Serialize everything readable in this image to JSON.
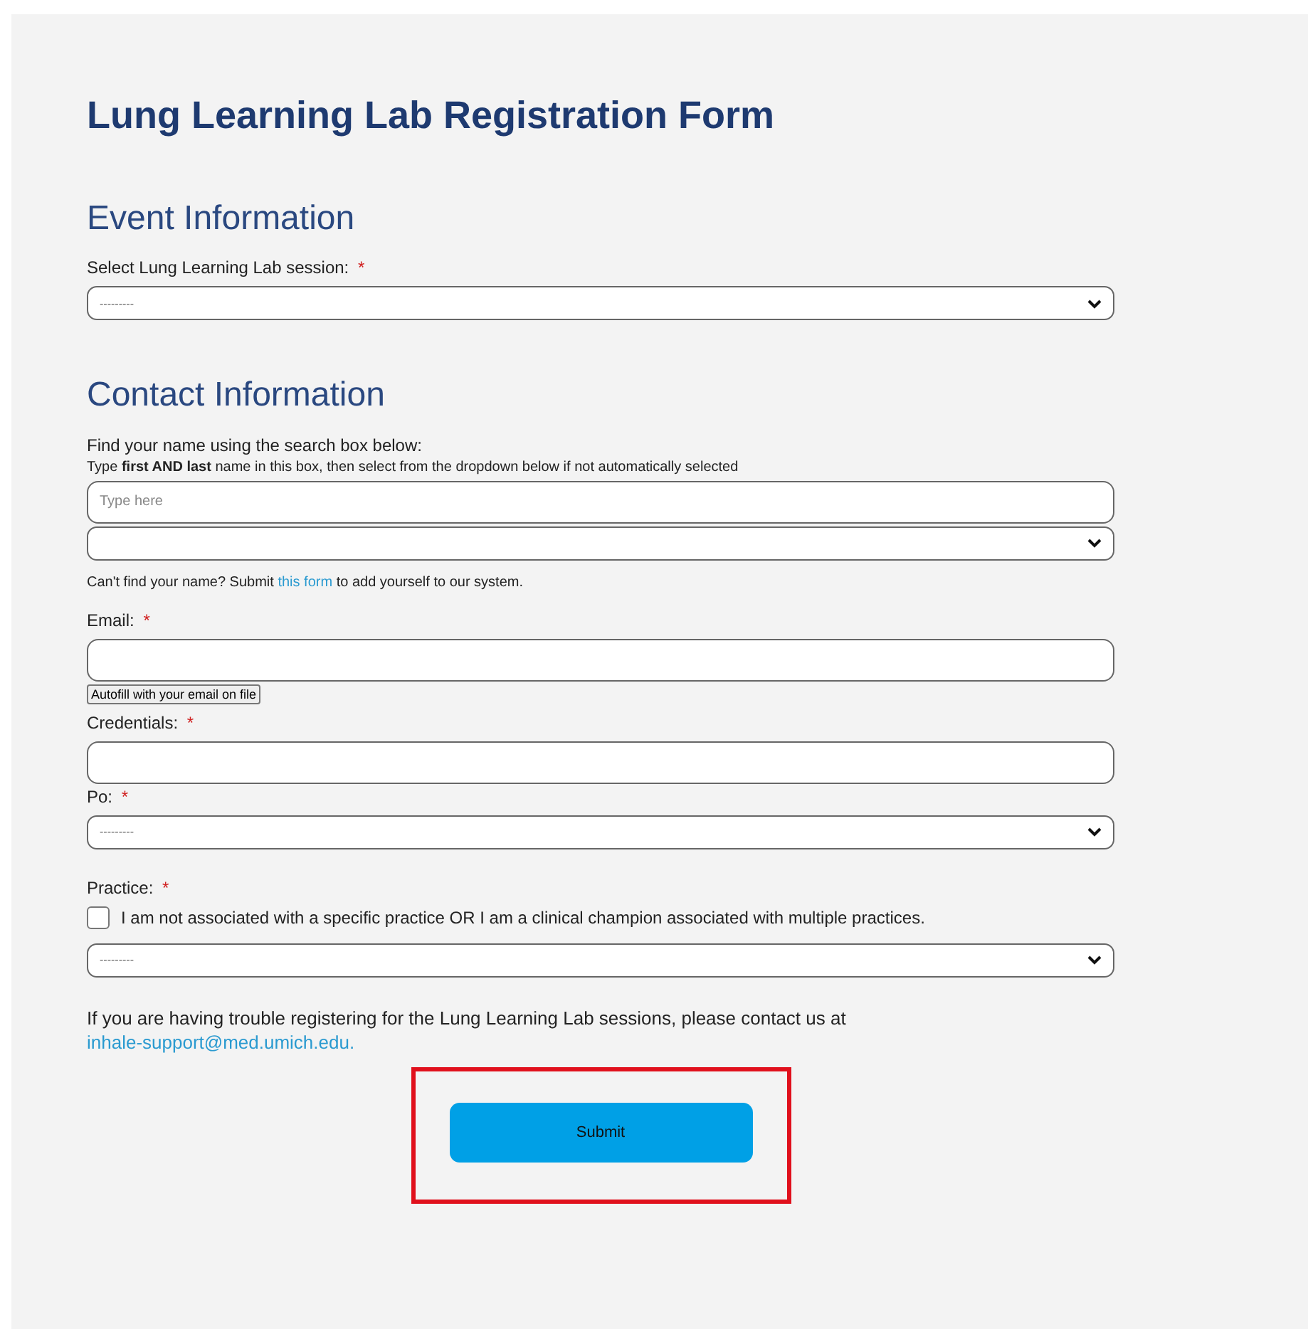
{
  "title": "Lung Learning Lab Registration Form",
  "items": [
    {
      "kind": "heading",
      "text": "Event Information"
    },
    {
      "kind": "label",
      "text": "Select Lung Learning Lab session:",
      "mark": "*"
    },
    {
      "kind": "select",
      "value": "---------"
    },
    {
      "kind": "heading",
      "text": "Contact Information"
    },
    {
      "kind": "label",
      "text": "Find your name using the search box below:"
    },
    {
      "kind": "hint",
      "text": "Type **first AND last** name in this box, then select from the dropdown below if not automatically selected"
    },
    {
      "kind": "input",
      "placeholder": "Type here"
    },
    {
      "kind": "select",
      "value": ""
    },
    {
      "kind": "note",
      "before": "Can't find your name? Submit ",
      "link": "this form",
      "after": " to add yourself to our system."
    },
    {
      "kind": "label",
      "text": "Email:",
      "mark": "*"
    },
    {
      "kind": "input"
    },
    {
      "kind": "small_button",
      "text": "Autofill with your email on file"
    },
    {
      "kind": "label",
      "text": "Credentials:",
      "mark": "*"
    },
    {
      "kind": "input"
    },
    {
      "kind": "label",
      "text": "Po:",
      "mark": "*"
    },
    {
      "kind": "select",
      "value": "---------"
    },
    {
      "kind": "label",
      "text": "Practice:",
      "mark": "*"
    },
    {
      "kind": "checkbox",
      "text": "I am not associated with a specific practice OR I am a clinical champion associated with multiple practices.",
      "checked": false
    },
    {
      "kind": "select",
      "value": "---------"
    }
  ],
  "contact": {
    "text": "If you are having trouble registering for the Lung Learning Lab sessions, please contact us at ",
    "link": "inhale-support@med.umich.edu."
  },
  "submit": {
    "label": "Submit",
    "highlighted": true
  }
}
